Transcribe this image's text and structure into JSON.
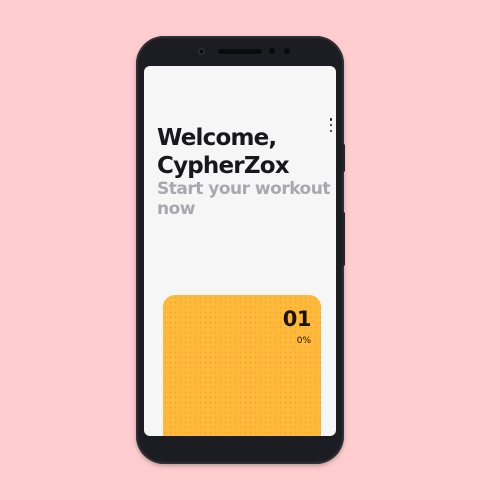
{
  "header": {
    "greeting": "Welcome,",
    "username": "CypherZox",
    "subtitle_line1": "Start your workout",
    "subtitle_line2": "now"
  },
  "menu": {
    "icon": "more-vert-icon"
  },
  "workout_card": {
    "number": "01",
    "progress_label": "0%",
    "progress": 0,
    "color": "#ffb93b"
  },
  "background_color": "#ffcdcf"
}
